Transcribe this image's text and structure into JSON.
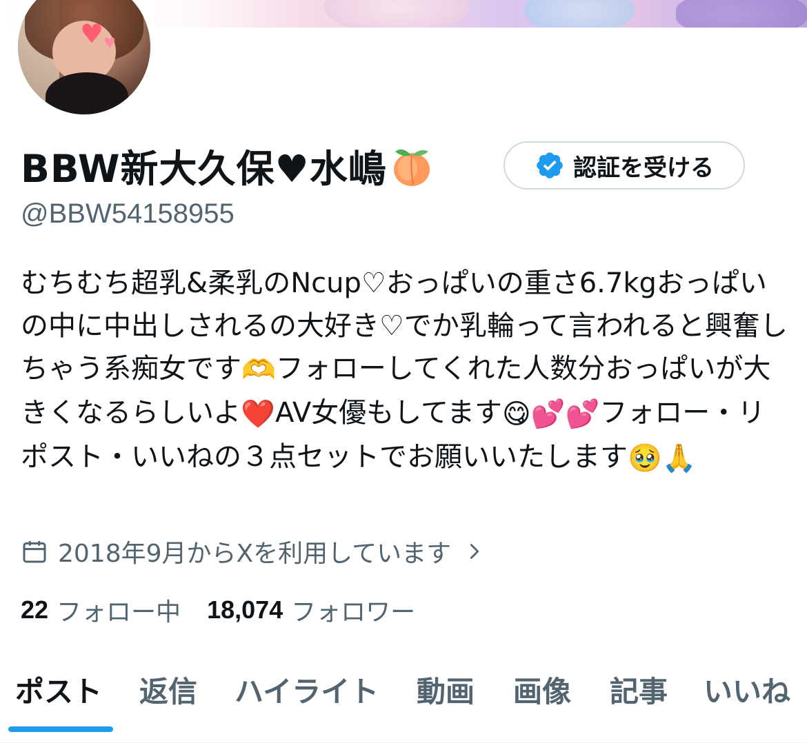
{
  "profile": {
    "display_name": "BBW新大久保♥水嶋",
    "handle": "@BBW54158955",
    "verify_button_label": "認証を受ける",
    "bio_parts": {
      "p1": "むちむち超乳&柔乳のNcup♡おっぱいの重さ6.7kgおっぱいの中に中出しされるの大好き♡でか乳輪って言われると興奮しちゃう系痴女です",
      "e1": "🫶",
      "p2": "フォローしてくれた人数分おっぱいが大きくなるらしいよ",
      "e2": "❤️",
      "p3": "AV女優もしてます",
      "e3": "😋",
      "e4": "💕",
      "e5": "💕",
      "p4": "フォロー・リポスト・いいねの３点セットでお願いいたします",
      "e6": "🥹",
      "e7": "🙏"
    },
    "joined": "2018年9月からXを利用しています",
    "following_count": "22",
    "following_label": "フォロー中",
    "followers_count": "18,074",
    "followers_label": "フォロワー"
  },
  "tabs": [
    {
      "label": "ポスト",
      "active": true
    },
    {
      "label": "返信"
    },
    {
      "label": "ハイライト"
    },
    {
      "label": "動画"
    },
    {
      "label": "画像"
    },
    {
      "label": "記事"
    },
    {
      "label": "いいね"
    }
  ],
  "colors": {
    "accent": "#1d9bf0",
    "text_primary": "#0f1419",
    "text_secondary": "#536471",
    "button_border": "#cfd9de"
  },
  "icons": {
    "verify": "verified-badge-icon",
    "calendar": "calendar-icon",
    "chevron": "chevron-right-icon",
    "peach": "peach-emoji-icon"
  }
}
